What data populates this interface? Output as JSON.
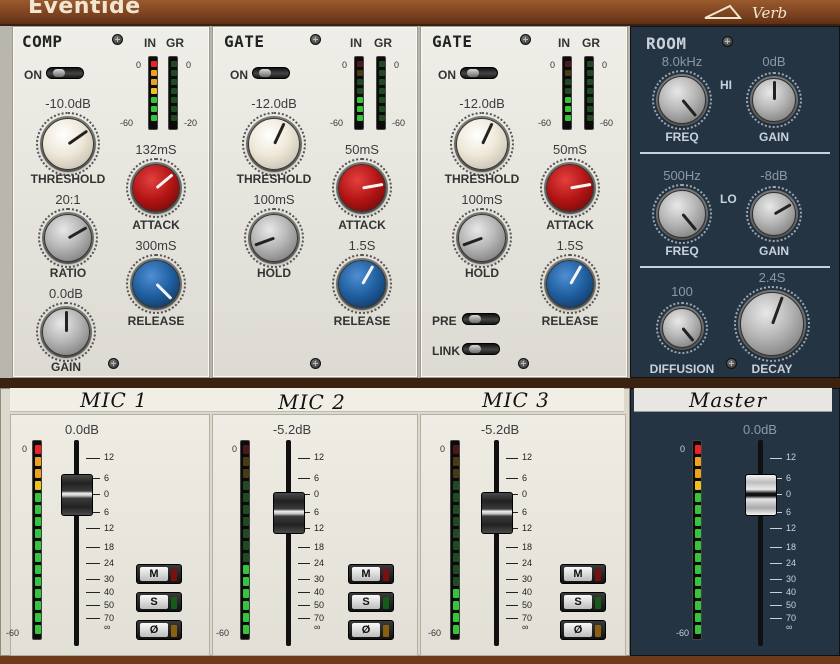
{
  "brand": "Eventide",
  "logo": "Verb",
  "colors": {
    "red_knob": "#b21414",
    "blue_knob": "#1e5e9e",
    "panel_dark": "#253443",
    "led_green": "#36c43a",
    "led_red": "#e22",
    "led_amber": "#f0a020"
  },
  "comp": {
    "title": "COMP",
    "on_label": "ON",
    "in_label": "IN",
    "gr_label": "GR",
    "meter_in_top": "0",
    "meter_in_bottom": "-60",
    "meter_gr_top": "0",
    "meter_gr_bottom": "-20",
    "threshold": {
      "value": "-10.0dB",
      "label": "THRESHOLD"
    },
    "ratio": {
      "value": "20:1",
      "label": "RATIO"
    },
    "gain": {
      "value": "0.0dB",
      "label": "GAIN"
    },
    "attack": {
      "value": "132mS",
      "label": "ATTACK"
    },
    "release": {
      "value": "300mS",
      "label": "RELEASE"
    }
  },
  "gate1": {
    "title": "GATE",
    "on_label": "ON",
    "in_label": "IN",
    "gr_label": "GR",
    "meter_in_top": "0",
    "meter_in_bottom": "-60",
    "meter_gr_top": "0",
    "meter_gr_bottom": "-60",
    "threshold": {
      "value": "-12.0dB",
      "label": "THRESHOLD"
    },
    "hold": {
      "value": "100mS",
      "label": "HOLD"
    },
    "attack": {
      "value": "50mS",
      "label": "ATTACK"
    },
    "release": {
      "value": "1.5S",
      "label": "RELEASE"
    }
  },
  "gate2": {
    "title": "GATE",
    "on_label": "ON",
    "in_label": "IN",
    "gr_label": "GR",
    "meter_in_top": "0",
    "meter_in_bottom": "-60",
    "meter_gr_top": "0",
    "meter_gr_bottom": "-60",
    "threshold": {
      "value": "-12.0dB",
      "label": "THRESHOLD"
    },
    "hold": {
      "value": "100mS",
      "label": "HOLD"
    },
    "attack": {
      "value": "50mS",
      "label": "ATTACK"
    },
    "release": {
      "value": "1.5S",
      "label": "RELEASE"
    },
    "pre_label": "PRE",
    "link_label": "LINK"
  },
  "room": {
    "title": "ROOM",
    "hi_label": "HI",
    "lo_label": "LO",
    "hi_freq": {
      "value": "8.0kHz",
      "label": "FREQ"
    },
    "hi_gain": {
      "value": "0dB",
      "label": "GAIN"
    },
    "lo_freq": {
      "value": "500Hz",
      "label": "FREQ"
    },
    "lo_gain": {
      "value": "-8dB",
      "label": "GAIN"
    },
    "diffusion": {
      "value": "100",
      "label": "DIFFUSION"
    },
    "decay": {
      "value": "2.4S",
      "label": "DECAY"
    }
  },
  "scale_labels": [
    "12",
    "6",
    "0",
    "6",
    "12",
    "18",
    "24",
    "30",
    "40",
    "50",
    "70",
    "∞"
  ],
  "strips": [
    {
      "name": "MIC 1",
      "level": "0.0dB",
      "meter_top": "0",
      "meter_bottom": "-60",
      "mute": "M",
      "solo": "S",
      "phase": "Ø"
    },
    {
      "name": "MIC 2",
      "level": "-5.2dB",
      "meter_top": "0",
      "meter_bottom": "-60",
      "mute": "M",
      "solo": "S",
      "phase": "Ø"
    },
    {
      "name": "MIC 3",
      "level": "-5.2dB",
      "meter_top": "0",
      "meter_bottom": "-60",
      "mute": "M",
      "solo": "S",
      "phase": "Ø"
    }
  ],
  "master": {
    "name": "Master",
    "level": "0.0dB",
    "meter_top": "0",
    "meter_bottom": "-60"
  }
}
